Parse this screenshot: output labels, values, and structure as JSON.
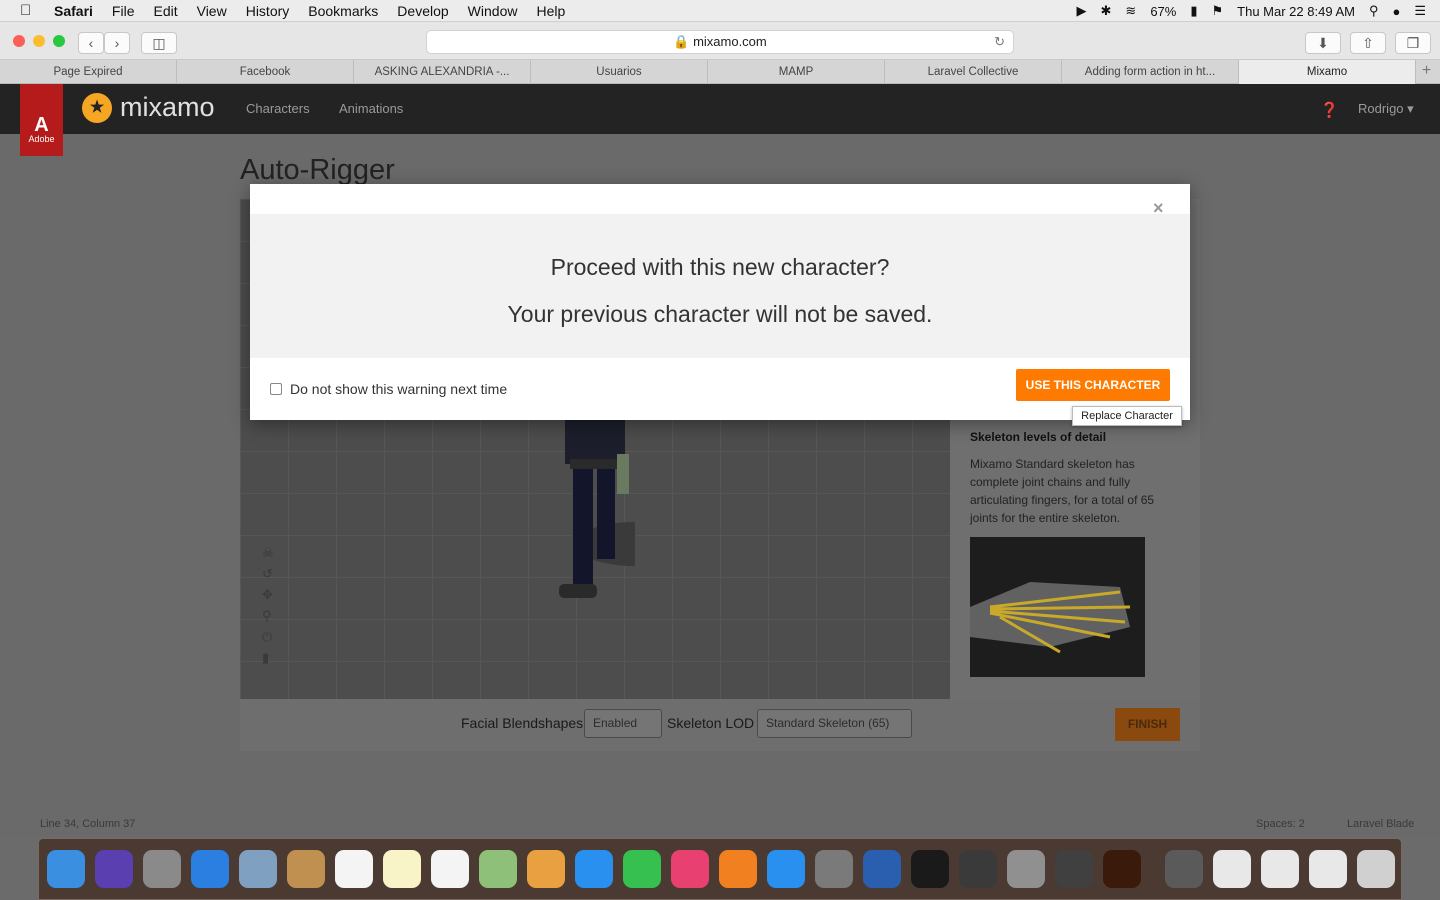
{
  "menubar": {
    "app": "Safari",
    "items": [
      "File",
      "Edit",
      "View",
      "History",
      "Bookmarks",
      "Develop",
      "Window",
      "Help"
    ],
    "battery": "67%",
    "clock": "Thu Mar 22  8:49 AM"
  },
  "toolbar": {
    "url": "mixamo.com"
  },
  "tabs": [
    "Page Expired",
    "Facebook",
    "ASKING ALEXANDRIA -...",
    "Usuarios",
    "MAMP",
    "Laravel Collective",
    "Adding form action in ht...",
    "Mixamo"
  ],
  "app": {
    "adobe_label": "Adobe",
    "brand": "mixamo",
    "nav": [
      "Characters",
      "Animations"
    ],
    "user": "Rodrigo"
  },
  "page": {
    "title": "Auto-Rigger",
    "side_heading": "Skeleton levels of detail",
    "side_text": "Mixamo Standard skeleton has complete joint chains and fully articulating fingers, for a total of 65 joints for the entire skeleton.",
    "facial_label": "Facial Blendshapes",
    "facial_value": "Enabled",
    "lod_label": "Skeleton LOD",
    "lod_value": "Standard Skeleton (65)",
    "finish": "FINISH"
  },
  "modal": {
    "line1": "Proceed with this new character?",
    "line2": "Your previous character will not be saved.",
    "checkbox_label": "Do not show this warning next time",
    "button": "USE THIS CHARACTER",
    "tooltip": "Replace Character"
  },
  "status": {
    "left": "Line 34, Column 37",
    "right1": "Spaces: 2",
    "right2": "Laravel Blade"
  },
  "colors": {
    "accent": "#ff7a00",
    "adobe_red": "#b61b1b",
    "nav_bg": "#232323"
  }
}
